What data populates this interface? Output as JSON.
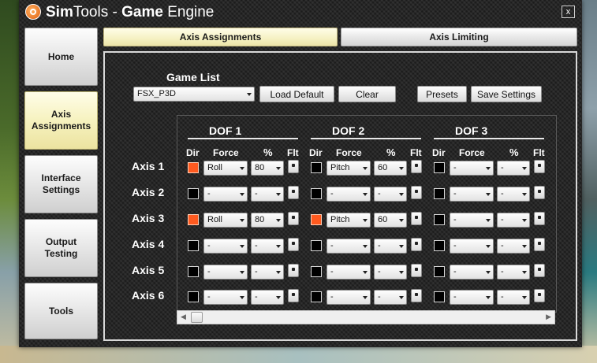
{
  "window": {
    "title_sim": "Sim",
    "title_tools": "Tools - ",
    "title_game": "Game",
    "title_engine": " Engine",
    "close_label": "x"
  },
  "sidebar": {
    "items": [
      {
        "label": "Home",
        "active": false
      },
      {
        "label": "Axis\nAssignments",
        "active": true
      },
      {
        "label": "Interface\nSettings",
        "active": false
      },
      {
        "label": "Output\nTesting",
        "active": false
      },
      {
        "label": "Tools",
        "active": false
      }
    ]
  },
  "tabs": [
    {
      "label": "Axis Assignments",
      "active": true
    },
    {
      "label": "Axis Limiting",
      "active": false
    }
  ],
  "game": {
    "list_label": "Game List",
    "selected": "FSX_P3D",
    "load_default": "Load Default",
    "clear": "Clear",
    "presets": "Presets",
    "save_settings": "Save Settings"
  },
  "dof": {
    "titles": [
      "DOF 1",
      "DOF 2",
      "DOF 3"
    ],
    "col_dir": "Dir",
    "col_force": "Force",
    "col_pct": "%",
    "col_flt": "Flt"
  },
  "axes": [
    {
      "label": "Axis 1",
      "dofs": [
        {
          "dir": true,
          "force": "Roll",
          "pct": "80"
        },
        {
          "dir": false,
          "force": "Pitch",
          "pct": "60"
        },
        {
          "dir": false,
          "force": "-",
          "pct": "-"
        }
      ]
    },
    {
      "label": "Axis 2",
      "dofs": [
        {
          "dir": false,
          "force": "-",
          "pct": "-"
        },
        {
          "dir": false,
          "force": "-",
          "pct": "-"
        },
        {
          "dir": false,
          "force": "-",
          "pct": "-"
        }
      ]
    },
    {
      "label": "Axis 3",
      "dofs": [
        {
          "dir": true,
          "force": "Roll",
          "pct": "80"
        },
        {
          "dir": true,
          "force": "Pitch",
          "pct": "60"
        },
        {
          "dir": false,
          "force": "-",
          "pct": "-"
        }
      ]
    },
    {
      "label": "Axis 4",
      "dofs": [
        {
          "dir": false,
          "force": "-",
          "pct": "-"
        },
        {
          "dir": false,
          "force": "-",
          "pct": "-"
        },
        {
          "dir": false,
          "force": "-",
          "pct": "-"
        }
      ]
    },
    {
      "label": "Axis 5",
      "dofs": [
        {
          "dir": false,
          "force": "-",
          "pct": "-"
        },
        {
          "dir": false,
          "force": "-",
          "pct": "-"
        },
        {
          "dir": false,
          "force": "-",
          "pct": "-"
        }
      ]
    },
    {
      "label": "Axis 6",
      "dofs": [
        {
          "dir": false,
          "force": "-",
          "pct": "-"
        },
        {
          "dir": false,
          "force": "-",
          "pct": "-"
        },
        {
          "dir": false,
          "force": "-",
          "pct": "-"
        }
      ]
    }
  ],
  "colors": {
    "dir_on": "#ff5a1f",
    "active_tab": "#f5f1c2"
  }
}
